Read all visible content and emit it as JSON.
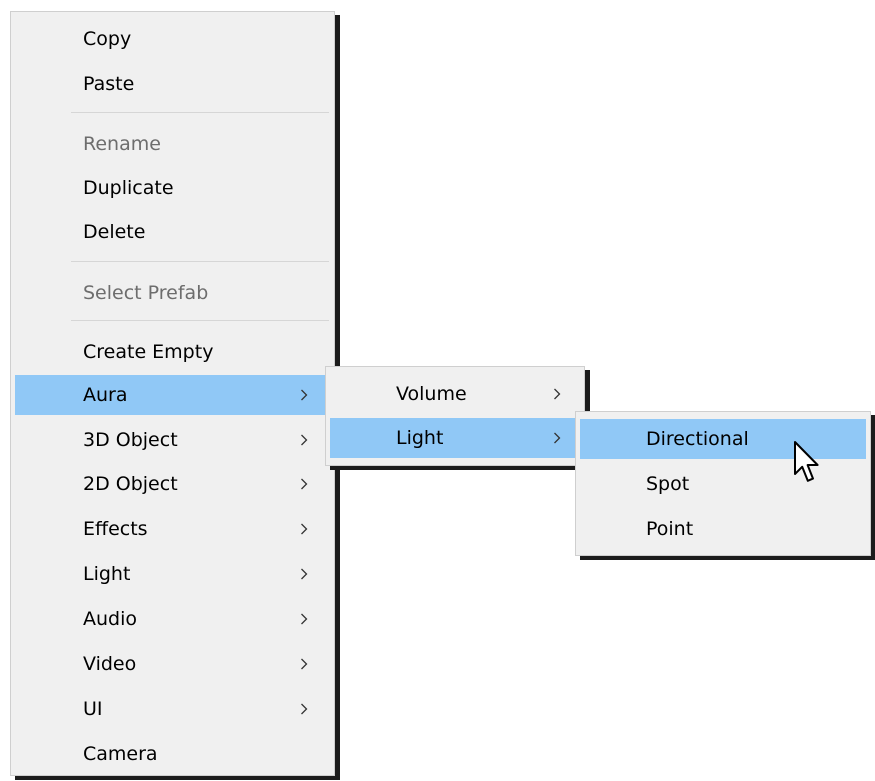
{
  "main_menu": {
    "items": [
      {
        "label": "Copy",
        "state": "normal"
      },
      {
        "label": "Paste",
        "state": "normal"
      },
      {
        "label": "Rename",
        "state": "disabled"
      },
      {
        "label": "Duplicate",
        "state": "normal"
      },
      {
        "label": "Delete",
        "state": "normal"
      },
      {
        "label": "Select Prefab",
        "state": "disabled"
      },
      {
        "label": "Create Empty",
        "state": "normal"
      },
      {
        "label": "Aura",
        "state": "highlighted",
        "submenu": true
      },
      {
        "label": "3D Object",
        "state": "normal",
        "submenu": true
      },
      {
        "label": "2D Object",
        "state": "normal",
        "submenu": true
      },
      {
        "label": "Effects",
        "state": "normal",
        "submenu": true
      },
      {
        "label": "Light",
        "state": "normal",
        "submenu": true
      },
      {
        "label": "Audio",
        "state": "normal",
        "submenu": true
      },
      {
        "label": "Video",
        "state": "normal",
        "submenu": true
      },
      {
        "label": "UI",
        "state": "normal",
        "submenu": true
      },
      {
        "label": "Camera",
        "state": "normal"
      }
    ]
  },
  "aura_submenu": {
    "items": [
      {
        "label": "Volume",
        "state": "normal",
        "submenu": true
      },
      {
        "label": "Light",
        "state": "highlighted",
        "submenu": true
      }
    ]
  },
  "light_submenu": {
    "items": [
      {
        "label": "Directional",
        "state": "highlighted"
      },
      {
        "label": "Spot",
        "state": "normal"
      },
      {
        "label": "Point",
        "state": "normal"
      }
    ]
  },
  "colors": {
    "menu_background": "#f0f0f0",
    "highlight": "#90c8f6",
    "disabled_text": "#6d6d6d",
    "shadow": "#1c1c1c"
  },
  "icons": {
    "submenu_arrow": "chevron-right-icon",
    "cursor": "mouse-pointer-icon"
  }
}
